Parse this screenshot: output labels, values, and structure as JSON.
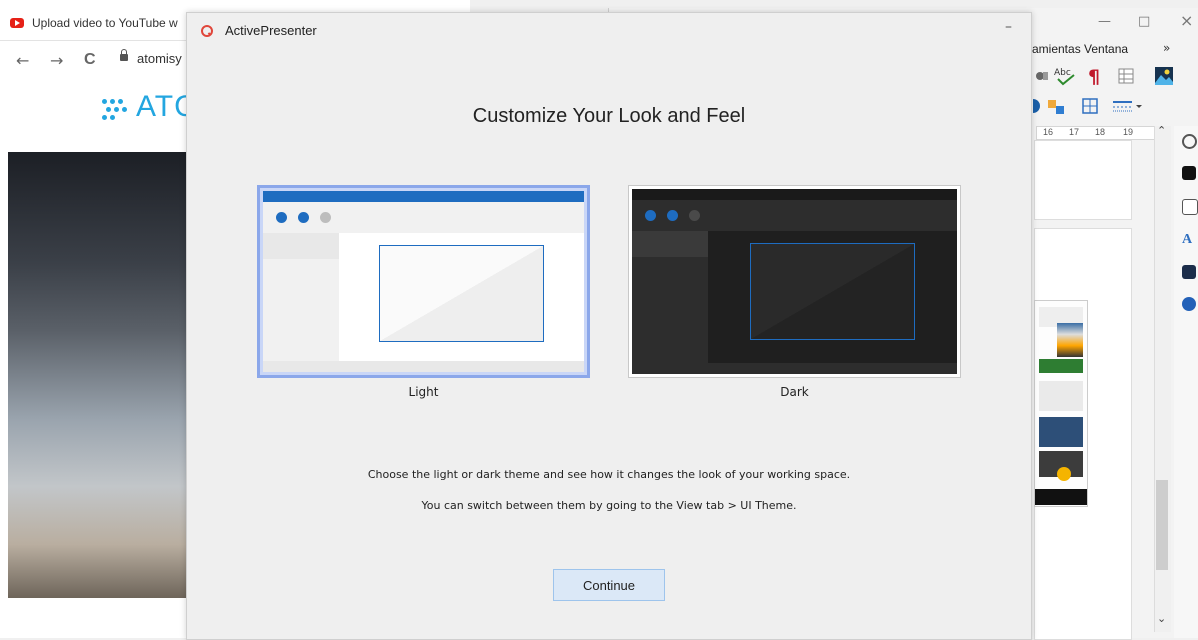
{
  "browser": {
    "tab_title": "Upload video to YouTube w",
    "back_glyph": "←",
    "forward_glyph": "→",
    "reload_glyph": "C",
    "url": "atomisy",
    "logo_text": "ATC",
    "icons": [
      "youtube-icon",
      "lock-icon",
      "site-logo-icon"
    ]
  },
  "office": {
    "minimize_glyph": "—",
    "maximize_glyph": "□",
    "close_glyph": "×",
    "menu_text": "amientas  Ventana",
    "menu_chevron": "»",
    "ruler_numbers": [
      "16",
      "17",
      "18",
      "19"
    ],
    "scroll_up_glyph": "⌃",
    "scroll_down_glyph": "⌄"
  },
  "dialog": {
    "app_title": "ActivePresenter",
    "minimize_glyph": "–",
    "heading": "Customize Your Look and Feel",
    "themes": [
      {
        "label": "Light",
        "selected": true
      },
      {
        "label": "Dark",
        "selected": false
      }
    ],
    "description_line1": "Choose the light or dark theme and see how it changes the look of your working space.",
    "description_line2": "You can switch between them by going to the View tab > UI Theme.",
    "continue_label": "Continue",
    "colors": {
      "accent": "#1e6cc0",
      "selected_border": "#8ba7ea",
      "light_bg": "#ffffff",
      "dark_bg": "#1f1f1f",
      "app_logo": "#e0463b"
    }
  }
}
